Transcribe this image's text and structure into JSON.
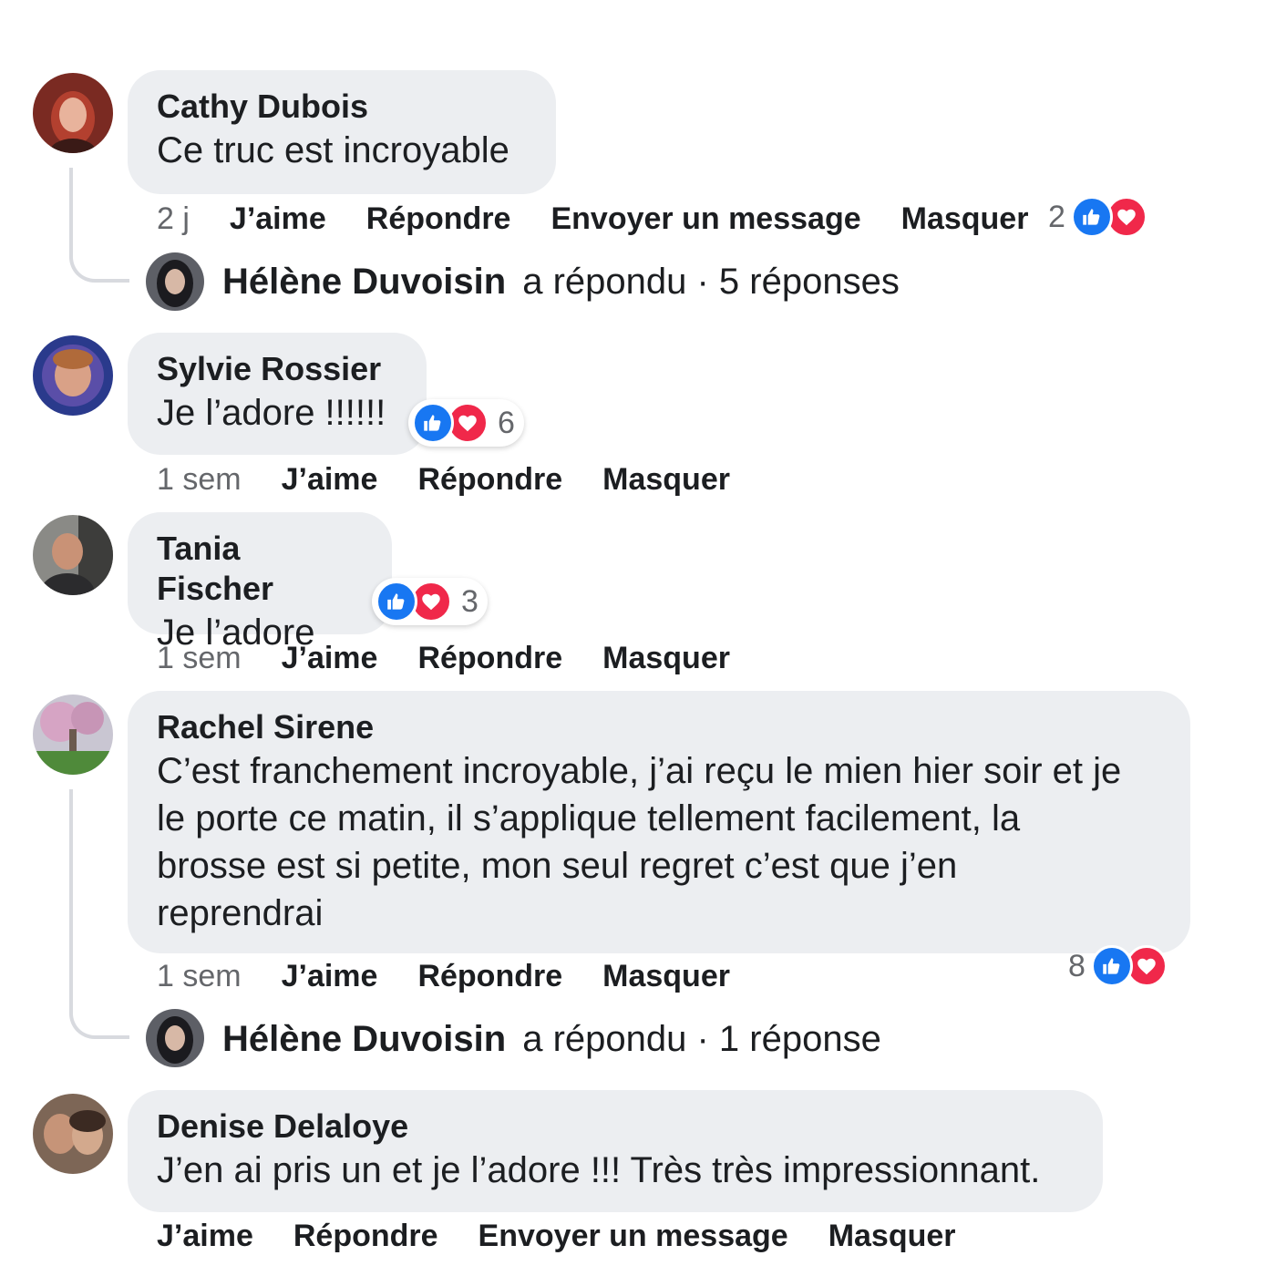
{
  "comments": [
    {
      "author": "Cathy Dubois",
      "text": "Ce truc est incroyable",
      "time": "2 j",
      "actions": [
        "J’aime",
        "Répondre",
        "Envoyer un message",
        "Masquer"
      ],
      "reaction_count": "2",
      "reply": {
        "name": "Hélène Duvoisin",
        "text": "a répondu · 5 réponses"
      }
    },
    {
      "author": "Sylvie Rossier",
      "text": "Je l’adore !!!!!!",
      "time": "1 sem",
      "actions": [
        "J’aime",
        "Répondre",
        "Masquer"
      ],
      "reaction_count": "6"
    },
    {
      "author": "Tania Fischer",
      "text": "Je l’adore",
      "time": "1 sem",
      "actions": [
        "J’aime",
        "Répondre",
        "Masquer"
      ],
      "reaction_count": "3"
    },
    {
      "author": "Rachel Sirene",
      "text_lines": [
        "C’est franchement incroyable, j’ai reçu le mien hier soir et je",
        "le porte ce matin, il s’applique tellement facilement, la",
        "brosse est si petite, mon seul regret c’est que j’en",
        "reprendrai"
      ],
      "time": "1 sem",
      "actions": [
        "J’aime",
        "Répondre",
        "Masquer"
      ],
      "reaction_count": "8",
      "reply": {
        "name": "Hélène Duvoisin",
        "text": "a répondu · 1 réponse"
      }
    },
    {
      "author": "Denise Delaloye",
      "text": "J’en ai pris un et je l’adore !!! Très très impressionnant.",
      "actions": [
        "J’aime",
        "Répondre",
        "Envoyer un message",
        "Masquer"
      ]
    }
  ],
  "icons": {
    "like": "thumbs-up-icon",
    "love": "heart-icon"
  },
  "colors": {
    "like": "#1877f2",
    "love": "#f0284a",
    "bubble": "#eceef1",
    "meta": "#65676b"
  }
}
